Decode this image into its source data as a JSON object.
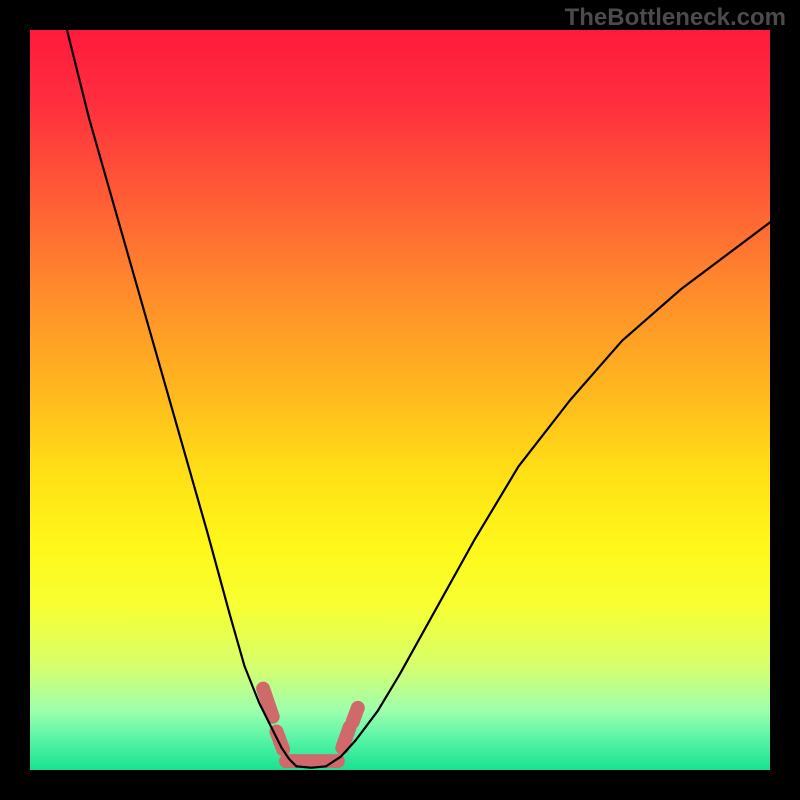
{
  "watermark": "TheBottleneck.com",
  "gradient_stops": [
    {
      "offset": 0.0,
      "color": "#ff1a3c"
    },
    {
      "offset": 0.1,
      "color": "#ff2f3e"
    },
    {
      "offset": 0.22,
      "color": "#ff5a36"
    },
    {
      "offset": 0.35,
      "color": "#ff8a2c"
    },
    {
      "offset": 0.48,
      "color": "#ffb51f"
    },
    {
      "offset": 0.6,
      "color": "#ffe016"
    },
    {
      "offset": 0.7,
      "color": "#fff81a"
    },
    {
      "offset": 0.78,
      "color": "#f7ff33"
    },
    {
      "offset": 0.86,
      "color": "#d6ff6e"
    },
    {
      "offset": 0.92,
      "color": "#9dffad"
    },
    {
      "offset": 0.96,
      "color": "#55f3a6"
    },
    {
      "offset": 1.0,
      "color": "#19e28e"
    }
  ],
  "curve_color": "#000000",
  "curve_width": 2.2,
  "marker_stroke": "#d06a6a",
  "marker_stroke_width": 14,
  "chart_data": {
    "type": "line",
    "title": "",
    "xlabel": "",
    "ylabel": "",
    "xlim": [
      0,
      100
    ],
    "ylim": [
      0,
      100
    ],
    "series": [
      {
        "name": "left-curve",
        "x": [
          5,
          8,
          12,
          16,
          20,
          24,
          27,
          29,
          31,
          33,
          34,
          35,
          36
        ],
        "y": [
          100,
          88,
          74,
          60,
          46,
          32,
          21,
          14,
          9,
          5,
          3,
          1.5,
          0.5
        ]
      },
      {
        "name": "right-curve",
        "x": [
          40,
          42,
          44,
          47,
          50,
          55,
          60,
          66,
          73,
          80,
          88,
          96,
          100
        ],
        "y": [
          0.5,
          1.8,
          4,
          8,
          13,
          22,
          31,
          41,
          50,
          58,
          65,
          71,
          74
        ]
      },
      {
        "name": "valley-floor",
        "x": [
          36,
          38,
          40
        ],
        "y": [
          0.5,
          0.3,
          0.5
        ]
      }
    ],
    "markers": [
      {
        "name": "left-marker-upper",
        "x1": 31.5,
        "y1": 11.0,
        "x2": 32.8,
        "y2": 7.2
      },
      {
        "name": "left-marker-lower",
        "x1": 33.3,
        "y1": 5.2,
        "x2": 34.2,
        "y2": 2.8
      },
      {
        "name": "right-marker-upper",
        "x1": 42.2,
        "y1": 3.0,
        "x2": 43.2,
        "y2": 5.8
      },
      {
        "name": "right-marker-lower",
        "x1": 43.6,
        "y1": 6.5,
        "x2": 44.3,
        "y2": 8.4
      },
      {
        "name": "valley-marker",
        "x1": 34.6,
        "y1": 1.2,
        "x2": 41.6,
        "y2": 1.2
      }
    ]
  }
}
